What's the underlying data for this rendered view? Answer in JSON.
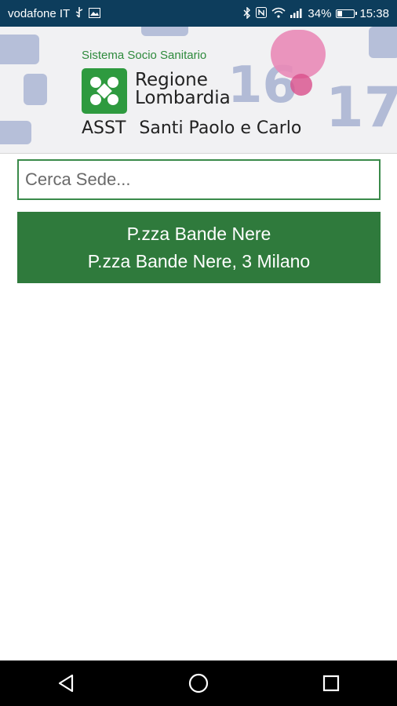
{
  "status_bar": {
    "carrier": "vodafone IT",
    "battery": "34%",
    "time": "15:38",
    "battery_level": 0.34,
    "icons": [
      "usb-icon",
      "image-icon",
      "bluetooth-icon",
      "nfc-icon",
      "wifi-icon",
      "signal-icon",
      "battery-icon"
    ]
  },
  "header": {
    "system_label": "Sistema Socio Sanitario",
    "region_line1": "Regione",
    "region_line2": "Lombardia",
    "asst_label": "ASST",
    "hospital_name": "Santi Paolo e Carlo",
    "background_numbers": [
      "16",
      "17"
    ],
    "logo_icon": "regione-lombardia-logo"
  },
  "search": {
    "placeholder": "Cerca Sede...",
    "value": ""
  },
  "results": [
    {
      "name": "P.zza Bande Nere",
      "address": "P.zza Bande Nere, 3 Milano"
    }
  ],
  "nav": {
    "back_icon": "back-icon",
    "home_icon": "home-icon",
    "recents_icon": "recents-icon"
  },
  "colors": {
    "status_bar": "#0d3d5c",
    "accent_green": "#2f7a3c",
    "logo_green": "#2e9a3f"
  }
}
